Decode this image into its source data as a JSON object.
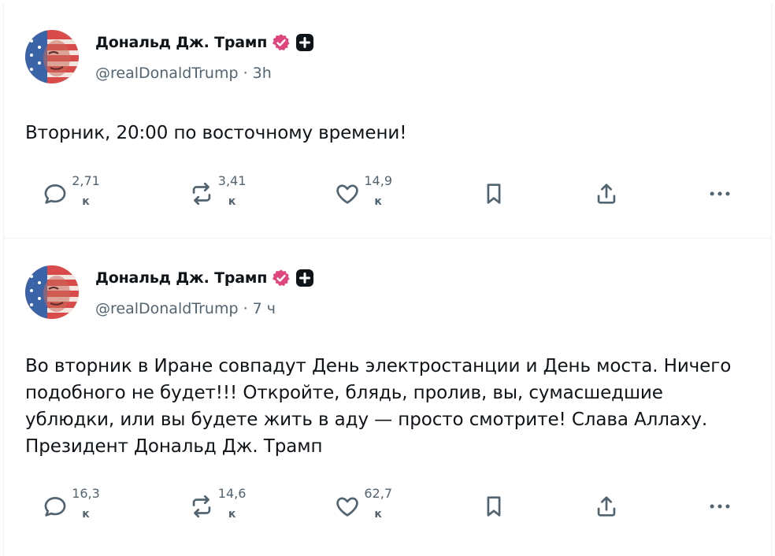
{
  "posts": [
    {
      "author": {
        "name": "Дональд Дж. Трамп",
        "handle": "@realDonaldTrump"
      },
      "time": "3h",
      "text": "Вторник, 20:00 по восточному времени!",
      "stats": {
        "replies": {
          "value": "2,71",
          "unit": "к"
        },
        "reposts": {
          "value": "3,41",
          "unit": "к"
        },
        "likes": {
          "value": "14,9",
          "unit": "к"
        }
      }
    },
    {
      "author": {
        "name": "Дональд Дж. Трамп",
        "handle": "@realDonaldTrump"
      },
      "time": "7 ч",
      "text": "Во вторник в Иране совпадут День электростанции и День моста. Ничего подобного не будет!!! Откройте, блядь, пролив, вы, сумасшедшие ублюдки, или вы будете жить в аду — просто смотрите! Слава Аллаху. Президент Дональд Дж. Трамп",
      "stats": {
        "replies": {
          "value": "16,3",
          "unit": "к"
        },
        "reposts": {
          "value": "14,6",
          "unit": "к"
        },
        "likes": {
          "value": "62,7",
          "unit": "к"
        }
      }
    }
  ],
  "icons": {
    "verified": "verified-badge-icon",
    "affiliate": "affiliate-plus-icon",
    "reply": "reply-icon",
    "repost": "repost-icon",
    "like": "heart-icon",
    "bookmark": "bookmark-icon",
    "share": "share-icon",
    "more": "more-icon"
  },
  "colors": {
    "verified": "#e0457b",
    "text": "#0f1419",
    "secondary": "#536471",
    "divider": "#eff3f4"
  }
}
